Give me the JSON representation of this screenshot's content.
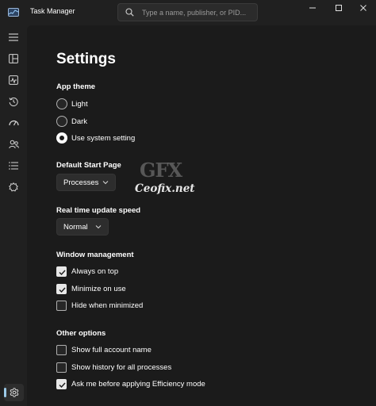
{
  "window": {
    "title": "Task Manager",
    "search_placeholder": "Type a name, publisher, or PID...",
    "app_icon": "task-manager-icon"
  },
  "sidebar": {
    "items": [
      {
        "icon": "hamburger-menu-icon"
      },
      {
        "icon": "processes-icon"
      },
      {
        "icon": "performance-icon"
      },
      {
        "icon": "app-history-icon"
      },
      {
        "icon": "startup-apps-icon"
      },
      {
        "icon": "users-icon"
      },
      {
        "icon": "details-icon"
      },
      {
        "icon": "services-icon"
      }
    ],
    "settings_icon": "gear-icon"
  },
  "settings": {
    "title": "Settings",
    "app_theme": {
      "label": "App theme",
      "options": [
        {
          "label": "Light",
          "selected": false
        },
        {
          "label": "Dark",
          "selected": false
        },
        {
          "label": "Use system setting",
          "selected": true
        }
      ]
    },
    "default_start_page": {
      "label": "Default Start Page",
      "value": "Processes"
    },
    "update_speed": {
      "label": "Real time update speed",
      "value": "Normal"
    },
    "window_management": {
      "label": "Window management",
      "options": [
        {
          "label": "Always on top",
          "checked": true
        },
        {
          "label": "Minimize on use",
          "checked": true
        },
        {
          "label": "Hide when minimized",
          "checked": false
        }
      ]
    },
    "other_options": {
      "label": "Other options",
      "options": [
        {
          "label": "Show full account name",
          "checked": false
        },
        {
          "label": "Show history for all processes",
          "checked": false
        },
        {
          "label": "Ask me before applying Efficiency mode",
          "checked": true
        }
      ]
    }
  },
  "watermark": {
    "logo": "GFX",
    "text": "Ceofix.net"
  },
  "colors": {
    "background": "#202020",
    "content": "#1b1b1b",
    "accent": "#9ccae8"
  }
}
